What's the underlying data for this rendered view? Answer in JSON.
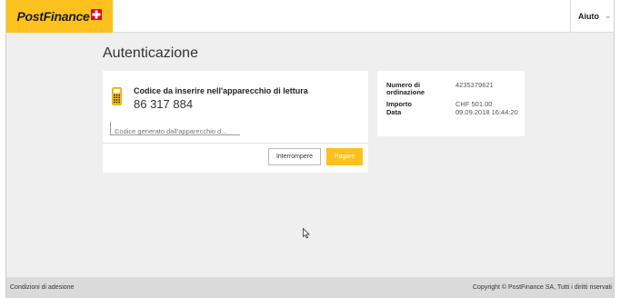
{
  "header": {
    "logo_text": "PostFinance",
    "help_label": "Aiuto",
    "brand_color": "#fcc11d"
  },
  "page": {
    "title": "Autenticazione"
  },
  "auth_card": {
    "code_label": "Codice da inserire nell'apparecchio di lettura",
    "code_value": "86 317 884",
    "input_placeholder": "Codice generato dall'apparecchio d...",
    "input_value": "",
    "cancel_label": "Interrompere",
    "pay_label": "Pagare",
    "icon": "card-reader-icon"
  },
  "order_summary": {
    "order_number_label": "Numero di ordinazione",
    "order_number_value": "4235379621",
    "amount_label": "Importo",
    "amount_value": "CHF 501.00",
    "date_label": "Data",
    "date_value": "09.09.2018 16:44:20"
  },
  "footer": {
    "terms_label": "Condizioni di adesione",
    "copyright": "Copyright © PostFinance SA, Tutti i diritti riservati"
  }
}
